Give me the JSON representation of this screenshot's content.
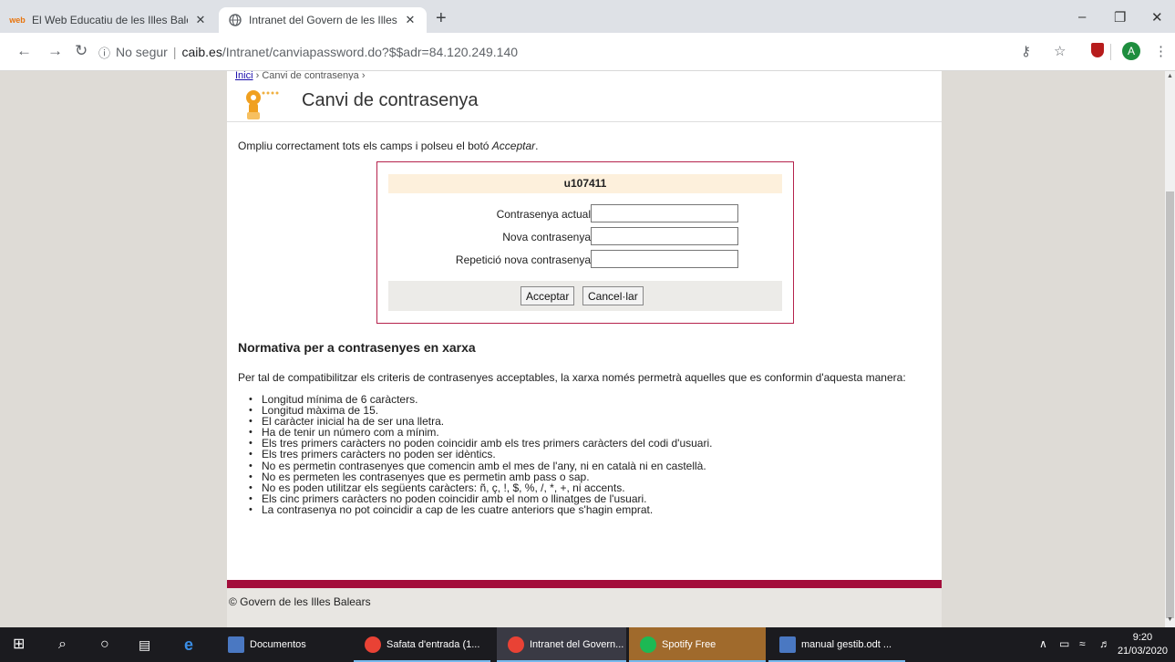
{
  "browser": {
    "tabs": [
      {
        "favicon": "web",
        "title": "El Web Educatiu de les Illes Balea",
        "close": "✕"
      },
      {
        "favicon": "globe-icon",
        "title": "Intranet del Govern de les Illes B",
        "close": "✕"
      }
    ],
    "new_tab": "+",
    "window_controls": {
      "minimize": "–",
      "maximize": "❐",
      "close": "✕"
    },
    "nav": {
      "back": "←",
      "forward": "→",
      "reload": "↻"
    },
    "address": {
      "info": "ⓘ",
      "security": "No segur",
      "host": "caib.es",
      "path": "/Intranet/canviapassword.do?$$adr=84.120.249.140"
    },
    "toolbar_icons": {
      "key": "⚷",
      "star": "☆",
      "avatar": "A",
      "menu": "⋮"
    }
  },
  "page": {
    "breadcrumb": {
      "home": "Inici",
      "separator": "›",
      "current": "Canvi de contrasenya"
    },
    "title": "Canvi de contrasenya",
    "intro_prefix": "Ompliu correctament tots els camps i polseu el botó ",
    "intro_emph": "Acceptar",
    "intro_suffix": ".",
    "form": {
      "username": "u107411",
      "fields": {
        "current_label": "Contrasenya actual",
        "current_value": "",
        "new_label": "Nova contrasenya",
        "new_value": "",
        "repeat_label": "Repetició nova contrasenya",
        "repeat_value": ""
      },
      "accept_label": "Acceptar",
      "cancel_label": "Cancel·lar"
    },
    "rules_title": "Normativa per a contrasenyes en xarxa",
    "rules_intro": "Per tal de compatibilitzar els criteris de contrasenyes acceptables, la xarxa només permetrà aquelles que es conformin d'aquesta manera:",
    "rules": [
      "Longitud mínima de 6 caràcters.",
      "Longitud màxima de 15.",
      "El caràcter inicial ha de ser una lletra.",
      "Ha de tenir un número com a mínim.",
      "Els tres primers caràcters no poden coincidir amb els tres primers caràcters del codi d'usuari.",
      "Els tres primers caràcters no poden ser idèntics.",
      "No es permetin contrasenyes que comencin amb el mes de l'any, ni en català ni en castellà.",
      "No es permeten les contrasenyes que es permetin amb pass o sap.",
      "No es poden utilitzar els següents caràcters: ñ, ç, !, $, %, /, *, +, ni accents.",
      "Els cinc primers caràcters no poden coincidir amb el nom o llinatges de l'usuari.",
      "La contrasenya no pot coincidir a cap de les cuatre anteriors que s'hagin emprat."
    ],
    "footer": "© Govern de les Illes Balears"
  },
  "taskbar": {
    "items": [
      {
        "label": "Documentos"
      },
      {
        "label": "Safata d'entrada (1..."
      },
      {
        "label": "Intranet del Govern..."
      },
      {
        "label": "Spotify Free"
      },
      {
        "label": "manual gestib.odt ..."
      }
    ],
    "time": "9:20",
    "date": "21/03/2020",
    "tray": "∧",
    "start": "⊞",
    "search": "⌕",
    "cortana": "○"
  },
  "colors": {
    "accent": "#a30e3b",
    "form_border": "#b5224c",
    "user_bar": "#fdf0dc"
  }
}
